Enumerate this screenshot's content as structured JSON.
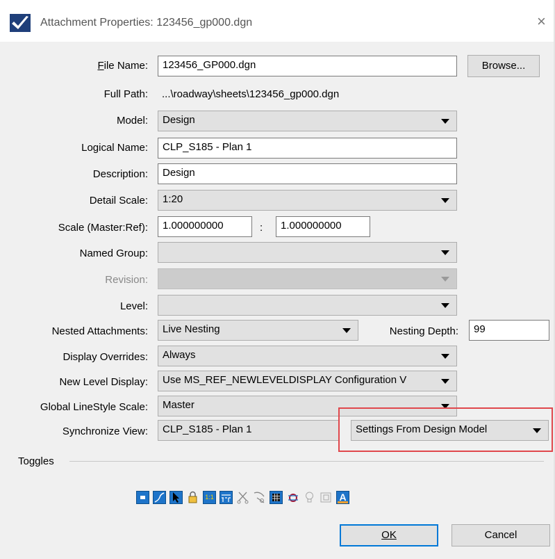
{
  "window": {
    "title": "Attachment Properties: 123456_gp000.dgn",
    "close_glyph": "×"
  },
  "file_name": {
    "label": "File Name:",
    "value": "123456_GP000.dgn",
    "browse": "Browse..."
  },
  "full_path": {
    "label": "Full Path:",
    "value": "...\\roadway\\sheets\\123456_gp000.dgn"
  },
  "model": {
    "label": "Model:",
    "value": "Design"
  },
  "logical_name": {
    "label": "Logical Name:",
    "value": "CLP_S185 - Plan 1"
  },
  "description": {
    "label": "Description:",
    "value": "Design"
  },
  "detail_scale": {
    "label": "Detail Scale:",
    "value": "1:20"
  },
  "scale": {
    "label": "Scale (Master:Ref):",
    "master": "1.000000000",
    "separator": ":",
    "ref": "1.000000000"
  },
  "named_group": {
    "label": "Named Group:",
    "value": ""
  },
  "revision": {
    "label": "Revision:",
    "value": ""
  },
  "level": {
    "label": "Level:",
    "value": ""
  },
  "nested": {
    "label": "Nested Attachments:",
    "value": "Live Nesting",
    "depth_label": "Nesting Depth:",
    "depth_value": "99"
  },
  "display_overrides": {
    "label": "Display Overrides:",
    "value": "Always"
  },
  "new_level_display": {
    "label": "New Level Display:",
    "value": "Use MS_REF_NEWLEVELDISPLAY Configuration V"
  },
  "global_linestyle": {
    "label": "Global LineStyle Scale:",
    "value": "Master"
  },
  "sync_view": {
    "label": "Synchronize View:",
    "value": "CLP_S185 - Plan 1",
    "settings": "Settings From Design Model"
  },
  "toggles": {
    "label": "Toggles",
    "scale_icon_text": "1:1",
    "annotation_icon_text": "A"
  },
  "buttons": {
    "ok": "OK",
    "cancel": "Cancel"
  },
  "colors": {
    "highlight": "#e0474c",
    "accent": "#0078d7",
    "icon_blue": "#1e74c9"
  }
}
